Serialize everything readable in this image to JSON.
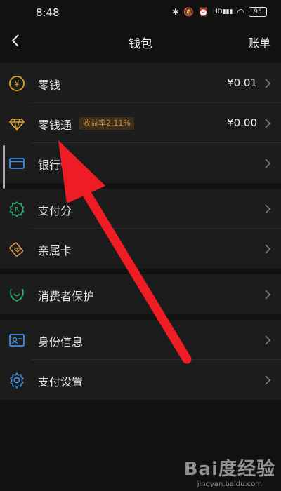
{
  "status_bar": {
    "time": "8:48",
    "battery": "95",
    "signal": "HD"
  },
  "nav": {
    "title": "钱包",
    "right_action": "账单"
  },
  "groups": [
    {
      "rows": [
        {
          "label": "零钱",
          "value": "¥0.01",
          "icon": "yuan-coin-icon"
        },
        {
          "label": "零钱通",
          "badge": "收益率2.11%",
          "value": "¥0.00",
          "icon": "diamond-icon"
        },
        {
          "label": "银行卡",
          "icon": "bank-card-icon"
        }
      ]
    },
    {
      "rows": [
        {
          "label": "支付分",
          "icon": "payment-score-icon"
        },
        {
          "label": "亲属卡",
          "icon": "family-card-icon"
        }
      ]
    },
    {
      "rows": [
        {
          "label": "消费者保护",
          "icon": "consumer-protection-icon"
        }
      ]
    },
    {
      "rows": [
        {
          "label": "身份信息",
          "icon": "id-card-icon"
        },
        {
          "label": "支付设置",
          "icon": "settings-gear-icon"
        }
      ]
    }
  ],
  "watermark": {
    "logo": "Bai度经验",
    "url": "jingyan.baidu.com"
  },
  "colors": {
    "background": "#111111",
    "row_bg": "#1c1c1c",
    "accent_gold": "#d9a52c",
    "accent_green": "#2bb673",
    "accent_blue": "#3b8fe6",
    "annotation_red": "#ee1c24"
  }
}
